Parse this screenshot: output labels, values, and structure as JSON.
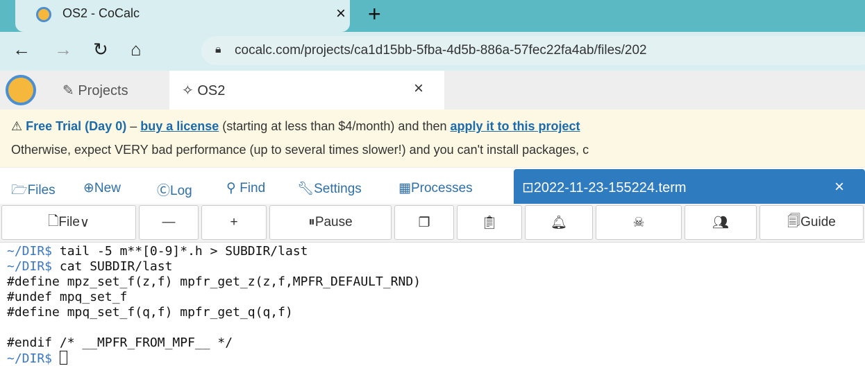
{
  "browser": {
    "tab_title": "OS2 - CoCalc",
    "tab_close": "×",
    "new_tab": "+",
    "url": "cocalc.com/projects/ca1d15bb-5fba-4d5b-886a-57fec22fa4ab/files/202"
  },
  "cocalc": {
    "projects_label": "Projects",
    "project_tab_label": "OS2",
    "project_tab_close": "×"
  },
  "banner": {
    "trial": "Free Trial (Day 0)",
    "dash": " – ",
    "buy_link": "buy a license",
    "mid": " (starting at less than $4/month) and then ",
    "apply_link": "apply it to this project",
    "line2": "Otherwise, expect VERY bad performance (up to several times slower!) and you can't install packages, c"
  },
  "projnav": {
    "files": "Files",
    "new": "New",
    "log": "Log",
    "find": "Find",
    "settings": "Settings",
    "processes": "Processes",
    "term_file": "2022-11-23-155224.term",
    "term_close": "×"
  },
  "toolbar": {
    "file": "File",
    "minus": "—",
    "plus": "+",
    "pause": "Pause",
    "guide": "Guide"
  },
  "terminal": {
    "prompt": "~/DIR$",
    "lines": [
      {
        "prompt": "~/DIR$",
        "text": " tail -5 m**[0-9]*.h > SUBDIR/last"
      },
      {
        "prompt": "~/DIR$",
        "text": " cat SUBDIR/last"
      },
      {
        "prompt": "",
        "text": "#define mpz_set_f(z,f) mpfr_get_z(z,f,MPFR_DEFAULT_RND)"
      },
      {
        "prompt": "",
        "text": "#undef mpq_set_f"
      },
      {
        "prompt": "",
        "text": "#define mpq_set_f(q,f) mpfr_get_q(q,f)"
      },
      {
        "prompt": "",
        "text": ""
      },
      {
        "prompt": "",
        "text": "#endif /* __MPFR_FROM_MPF__ */"
      }
    ]
  }
}
